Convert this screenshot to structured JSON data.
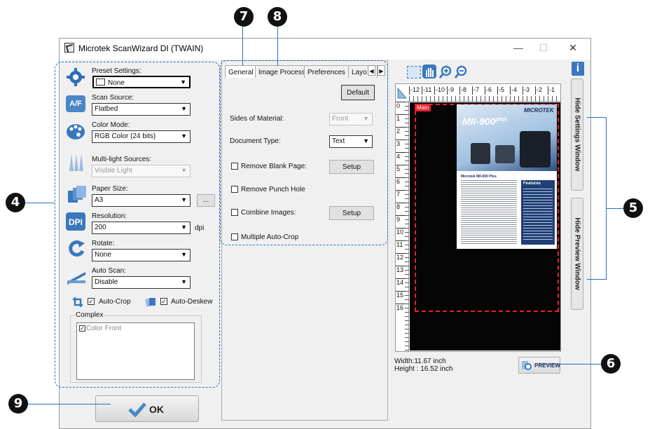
{
  "window": {
    "title": "Microtek ScanWizard DI (TWAIN)",
    "minimize": "—",
    "maximize": "☐",
    "close": "✕"
  },
  "settings": {
    "preset_label": "Preset Settings:",
    "preset_value": "None",
    "source_label": "Scan Source:",
    "source_value": "Flatbed",
    "color_label": "Color Mode:",
    "color_value": "RGB Color (24 bits)",
    "multilight_label": "Multi-light Sources:",
    "multilight_value": "Visible Light",
    "paper_label": "Paper Size:",
    "paper_value": "A3",
    "paper_more": "...",
    "resolution_label": "Resolution:",
    "resolution_value": "200",
    "resolution_unit": "dpi",
    "rotate_label": "Rotate:",
    "rotate_value": "None",
    "autoscan_label": "Auto Scan:",
    "autoscan_value": "Disable",
    "autocrop_label": "Auto-Crop",
    "autodeskew_label": "Auto-Deskew",
    "complex_label": "Complex",
    "complex_item": "Color Front",
    "icon_dpi_text": "DPI",
    "icon_af_text": "A/F"
  },
  "ok_label": "OK",
  "tabs": {
    "items": [
      "General",
      "Image Process",
      "Preferences",
      "Layo"
    ],
    "default_button": "Default",
    "sides_label": "Sides of Material:",
    "sides_value": "Front",
    "doctype_label": "Document Type:",
    "doctype_value": "Text",
    "remove_blank": "Remove Blank Page:",
    "remove_blank_btn": "Setup",
    "remove_punch": "Remove Punch Hole",
    "combine": "Combine Images:",
    "combine_btn": "Setup",
    "multi_crop": "Multiple Auto-Crop"
  },
  "preview": {
    "ruler_top": [
      "-12",
      "-11",
      "-10",
      "-9",
      "-8",
      "-7",
      "-6",
      "-5",
      "-4",
      "-3",
      "-2",
      "-1"
    ],
    "ruler_left": [
      "0",
      "1",
      "2",
      "3",
      "4",
      "5",
      "6",
      "7",
      "8",
      "9",
      "10",
      "11",
      "12",
      "13",
      "14",
      "15",
      "16"
    ],
    "main_tag": "Main",
    "brochure_logo": "MICROTEK",
    "brochure_title": "MII-900",
    "brochure_title_sup": "plus",
    "brochure_features": "Features",
    "brochure_subhead": "Microtek MII-900 Plus",
    "width_text": "Width:11.67 inch",
    "height_text": "Height : 16.52 inch",
    "preview_button": "PREVIEW",
    "hide_settings": "Hide  Settings Window",
    "hide_preview": "Hide  Preview Window",
    "info": "i"
  },
  "callouts": [
    "4",
    "5",
    "6",
    "7",
    "8",
    "9"
  ],
  "colors": {
    "dash": "#2a6fc4",
    "accent": "#e8202a"
  }
}
